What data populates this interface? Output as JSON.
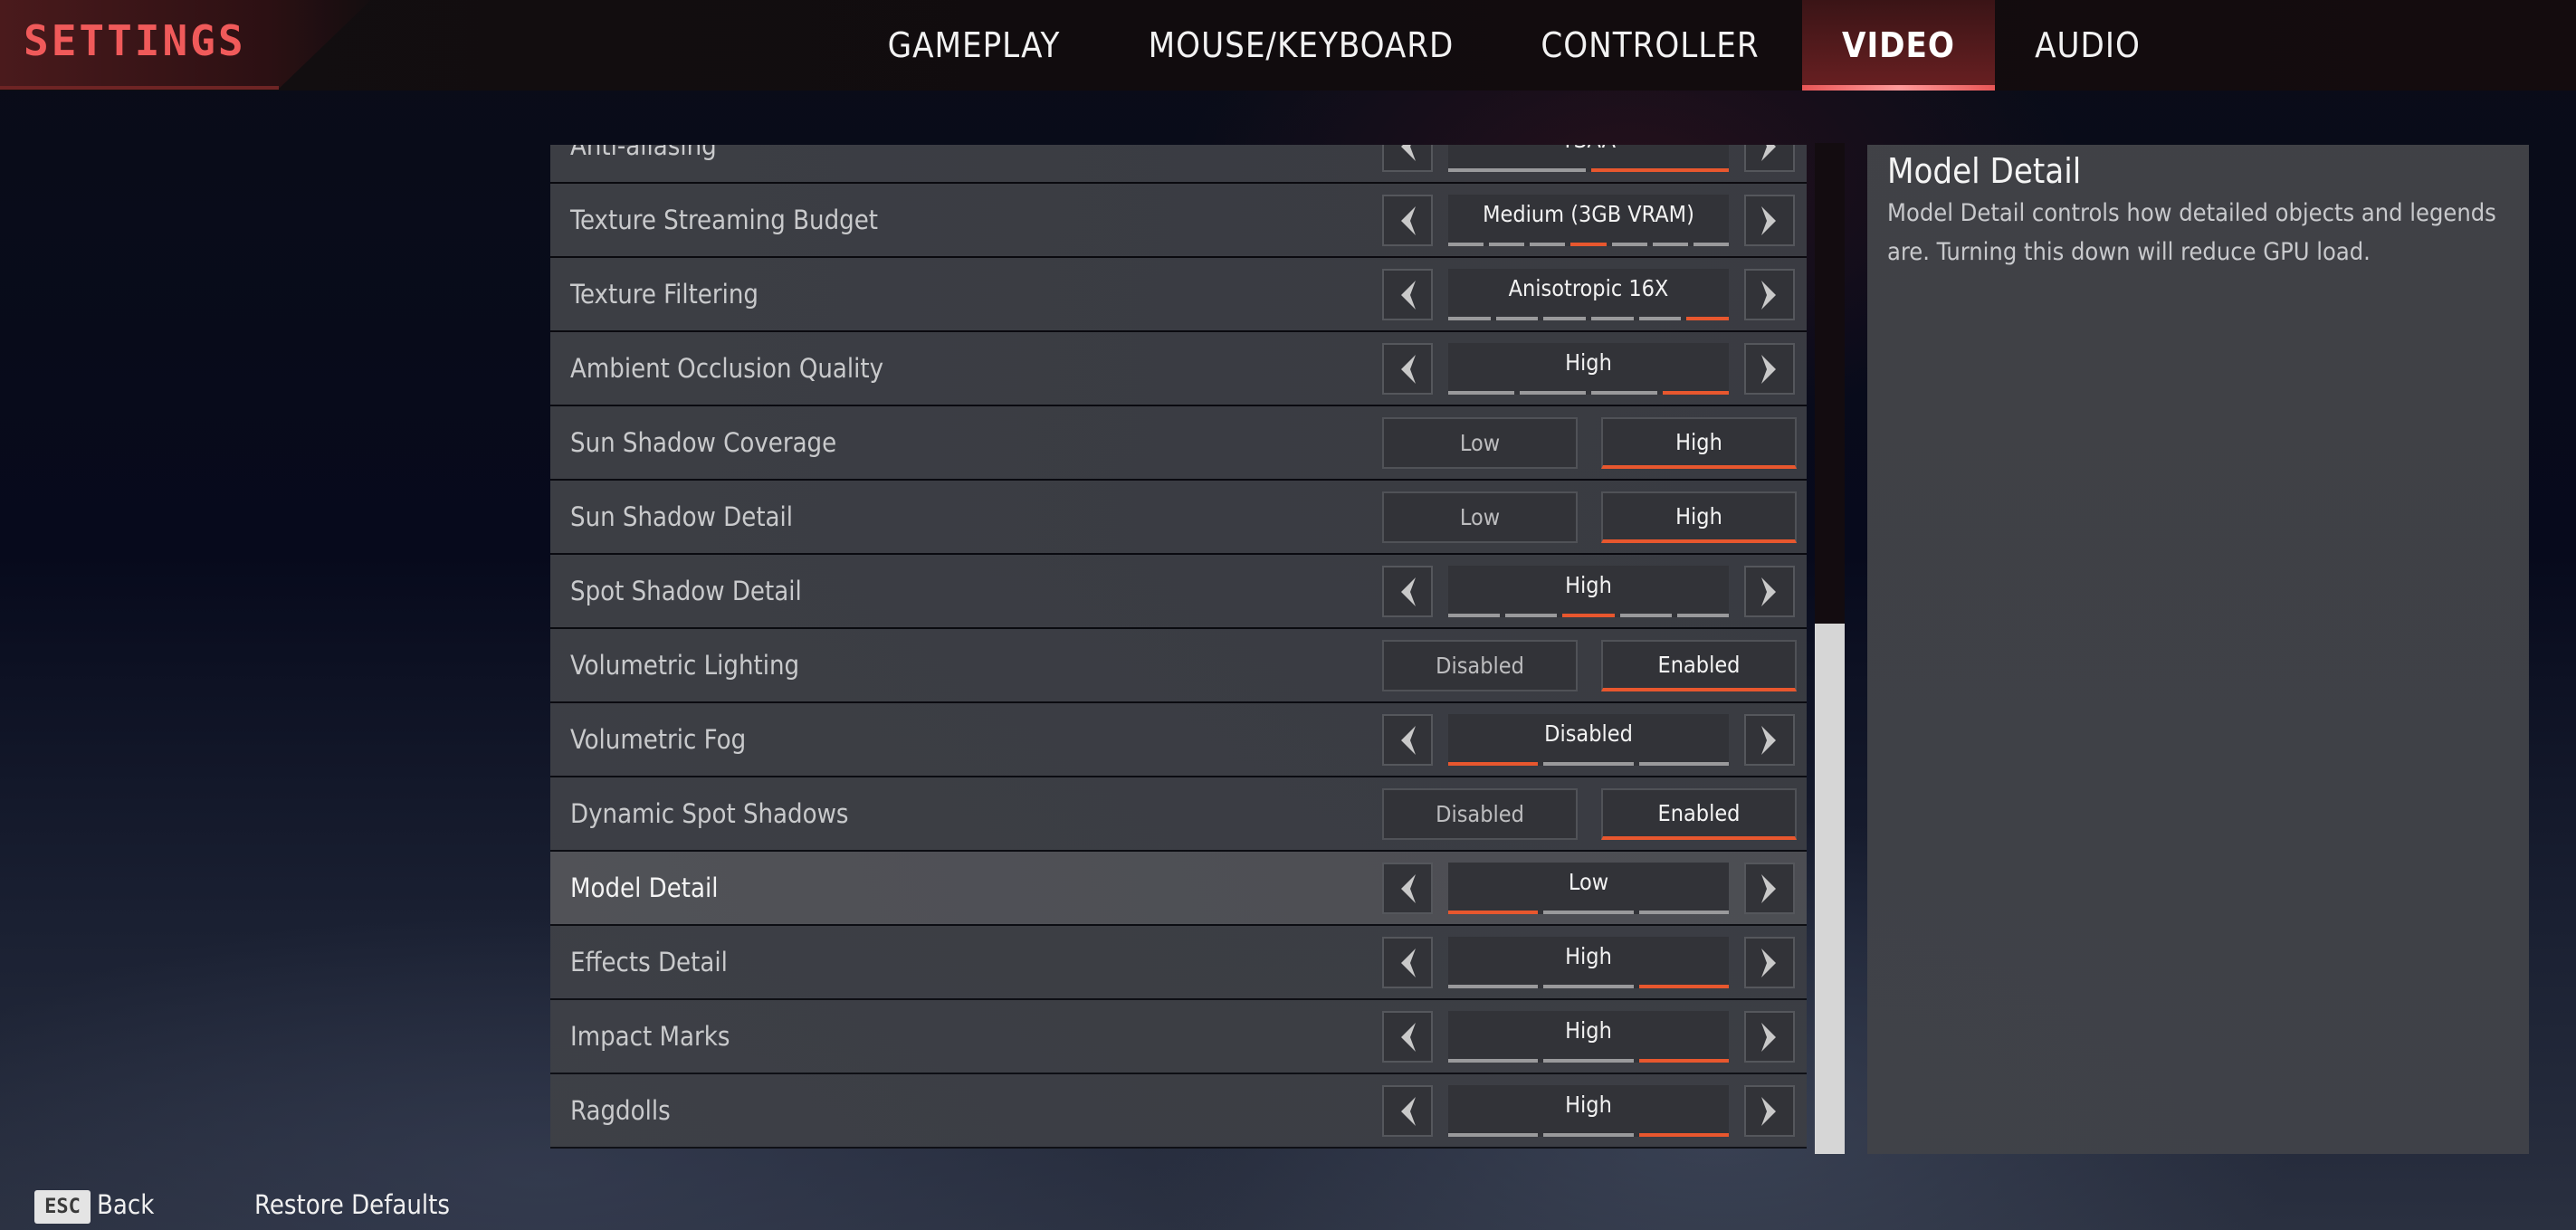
{
  "header": {
    "title": "SETTINGS",
    "tabs": [
      {
        "label": "GAMEPLAY",
        "active": false
      },
      {
        "label": "MOUSE/KEYBOARD",
        "active": false
      },
      {
        "label": "CONTROLLER",
        "active": false
      },
      {
        "label": "VIDEO",
        "active": true
      },
      {
        "label": "AUDIO",
        "active": false
      }
    ]
  },
  "settings": [
    {
      "label": "Anti-aliasing",
      "type": "selector",
      "value": "TSAA",
      "options_count": 2,
      "selected_index": 1
    },
    {
      "label": "Texture Streaming Budget",
      "type": "selector",
      "value": "Medium (3GB VRAM)",
      "options_count": 7,
      "selected_index": 3
    },
    {
      "label": "Texture Filtering",
      "type": "selector",
      "value": "Anisotropic 16X",
      "options_count": 6,
      "selected_index": 5
    },
    {
      "label": "Ambient Occlusion Quality",
      "type": "selector",
      "value": "High",
      "options_count": 4,
      "selected_index": 3
    },
    {
      "label": "Sun Shadow Coverage",
      "type": "toggle",
      "options": [
        "Low",
        "High"
      ],
      "selected_index": 1
    },
    {
      "label": "Sun Shadow Detail",
      "type": "toggle",
      "options": [
        "Low",
        "High"
      ],
      "selected_index": 1
    },
    {
      "label": "Spot Shadow Detail",
      "type": "selector",
      "value": "High",
      "options_count": 5,
      "selected_index": 2
    },
    {
      "label": "Volumetric Lighting",
      "type": "toggle",
      "options": [
        "Disabled",
        "Enabled"
      ],
      "selected_index": 1
    },
    {
      "label": "Volumetric Fog",
      "type": "selector",
      "value": "Disabled",
      "options_count": 3,
      "selected_index": 0
    },
    {
      "label": "Dynamic Spot Shadows",
      "type": "toggle",
      "options": [
        "Disabled",
        "Enabled"
      ],
      "selected_index": 1
    },
    {
      "label": "Model Detail",
      "type": "selector",
      "value": "Low",
      "options_count": 3,
      "selected_index": 0,
      "highlighted": true
    },
    {
      "label": "Effects Detail",
      "type": "selector",
      "value": "High",
      "options_count": 3,
      "selected_index": 2
    },
    {
      "label": "Impact Marks",
      "type": "selector",
      "value": "High",
      "options_count": 3,
      "selected_index": 2
    },
    {
      "label": "Ragdolls",
      "type": "selector",
      "value": "High",
      "options_count": 3,
      "selected_index": 2
    }
  ],
  "icons": {
    "prev": "chevron-left-icon",
    "next": "chevron-right-icon"
  },
  "scrollbar": {
    "thumb_start_fraction": 0.475,
    "thumb_size_fraction": 0.525
  },
  "description": {
    "title": "Model Detail",
    "body": "Model Detail controls how detailed objects and legends are. Turning this down will reduce GPU load."
  },
  "footer": {
    "esc_key": "ESC",
    "back_label": "Back",
    "restore_label": "Restore Defaults"
  },
  "colors": {
    "accent": "#e8572e",
    "title_red": "#f05a5a",
    "tab_active_underline": "#e85656",
    "scroll_thumb": "#d6d6d6"
  }
}
